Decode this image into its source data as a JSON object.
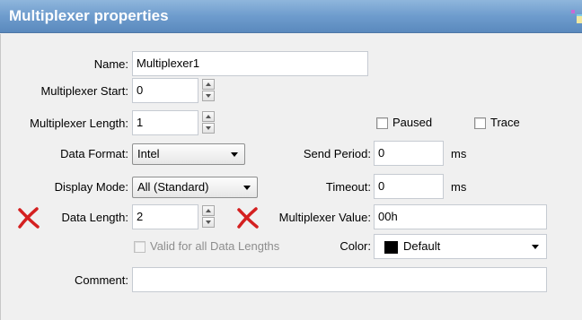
{
  "window": {
    "title": "Multiplexer properties"
  },
  "form": {
    "name": {
      "label": "Name:",
      "value": "Multiplexer1"
    },
    "multiplexer_start": {
      "label": "Multiplexer Start:",
      "value": "0"
    },
    "multiplexer_length": {
      "label": "Multiplexer Length:",
      "value": "1"
    },
    "paused": {
      "label": "Paused",
      "checked": false
    },
    "trace": {
      "label": "Trace",
      "checked": false
    },
    "data_format": {
      "label": "Data Format:",
      "value": "Intel"
    },
    "send_period": {
      "label": "Send Period:",
      "value": "0",
      "unit": "ms"
    },
    "display_mode": {
      "label": "Display Mode:",
      "value": "All (Standard)"
    },
    "timeout": {
      "label": "Timeout:",
      "value": "0",
      "unit": "ms"
    },
    "data_length": {
      "label": "Data Length:",
      "value": "2"
    },
    "multiplexer_value": {
      "label": "Multiplexer Value:",
      "value": "00h"
    },
    "valid_all_lengths": {
      "label": "Valid for all Data Lengths",
      "checked": false,
      "enabled": false
    },
    "color": {
      "label": "Color:",
      "value": "Default",
      "swatch": "#000000"
    },
    "comment": {
      "label": "Comment:",
      "value": ""
    }
  },
  "icons": {
    "error_marker": "red-x-icon",
    "corner": "window-corner-icon"
  },
  "colors": {
    "titlebar": "#6e9ccd",
    "error_x": "#d42020"
  }
}
